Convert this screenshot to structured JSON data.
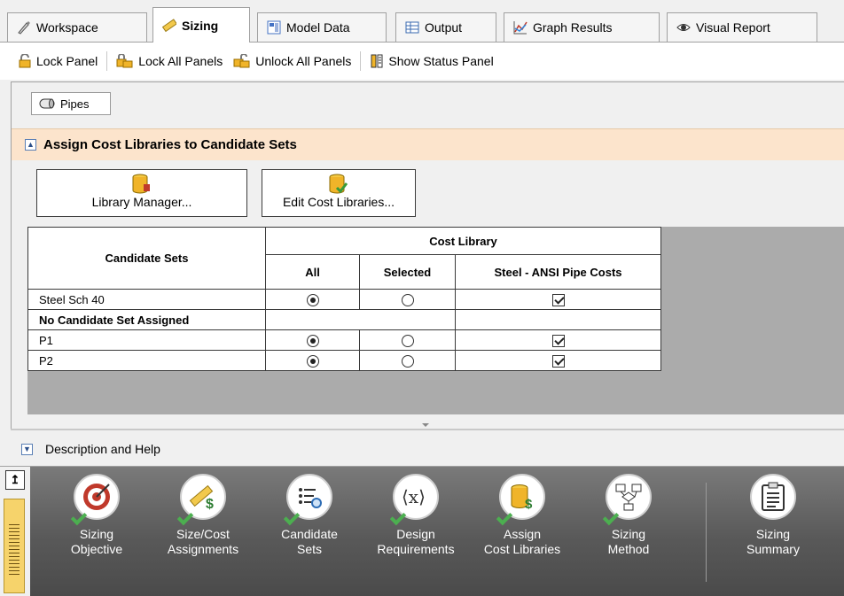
{
  "tabs": [
    {
      "label": "Workspace",
      "icon": "pencil-icon"
    },
    {
      "label": "Sizing",
      "icon": "ruler-icon",
      "active": true
    },
    {
      "label": "Model Data",
      "icon": "model-data-icon"
    },
    {
      "label": "Output",
      "icon": "table-icon"
    },
    {
      "label": "Graph Results",
      "icon": "graph-icon"
    },
    {
      "label": "Visual Report",
      "icon": "eye-icon"
    }
  ],
  "toolbar": {
    "lock_panel": "Lock Panel",
    "lock_all": "Lock All Panels",
    "unlock_all": "Unlock All Panels",
    "show_status": "Show Status Panel"
  },
  "pipes_button": "Pipes",
  "section": {
    "title": "Assign Cost Libraries to Candidate Sets",
    "library_manager": "Library Manager...",
    "edit_cost_libraries": "Edit Cost Libraries..."
  },
  "table": {
    "col_candidate": "Candidate Sets",
    "group_header": "Cost Library",
    "col_all": "All",
    "col_selected": "Selected",
    "col_steel": "Steel - ANSI Pipe Costs",
    "rows": [
      {
        "name": "Steel Sch 40",
        "all": true,
        "selected": false,
        "steel": true,
        "bold": false
      },
      {
        "name": "No Candidate Set Assigned",
        "bold": true,
        "group": true
      },
      {
        "name": "P1",
        "all": true,
        "selected": false,
        "steel": true,
        "bold": false
      },
      {
        "name": "P2",
        "all": true,
        "selected": false,
        "steel": true,
        "bold": false
      }
    ]
  },
  "description": "Description and Help",
  "steps": [
    {
      "line1": "Sizing",
      "line2": "Objective",
      "icon": "target-icon",
      "done": true
    },
    {
      "line1": "Size/Cost",
      "line2": "Assignments",
      "icon": "ruler-dollar-icon",
      "done": true
    },
    {
      "line1": "Candidate",
      "line2": "Sets",
      "icon": "list-search-icon",
      "done": true
    },
    {
      "line1": "Design",
      "line2": "Requirements",
      "icon": "variable-icon",
      "done": true
    },
    {
      "line1": "Assign",
      "line2": "Cost Libraries",
      "icon": "database-dollar-icon",
      "done": true
    },
    {
      "line1": "Sizing",
      "line2": "Method",
      "icon": "flowchart-icon",
      "done": true
    },
    {
      "line1": "Sizing",
      "line2": "Summary",
      "icon": "clipboard-icon",
      "done": false
    }
  ],
  "colors": {
    "section_bg": "#fce4cc",
    "bar_bg": "#595959",
    "check_green": "#4caf50"
  }
}
